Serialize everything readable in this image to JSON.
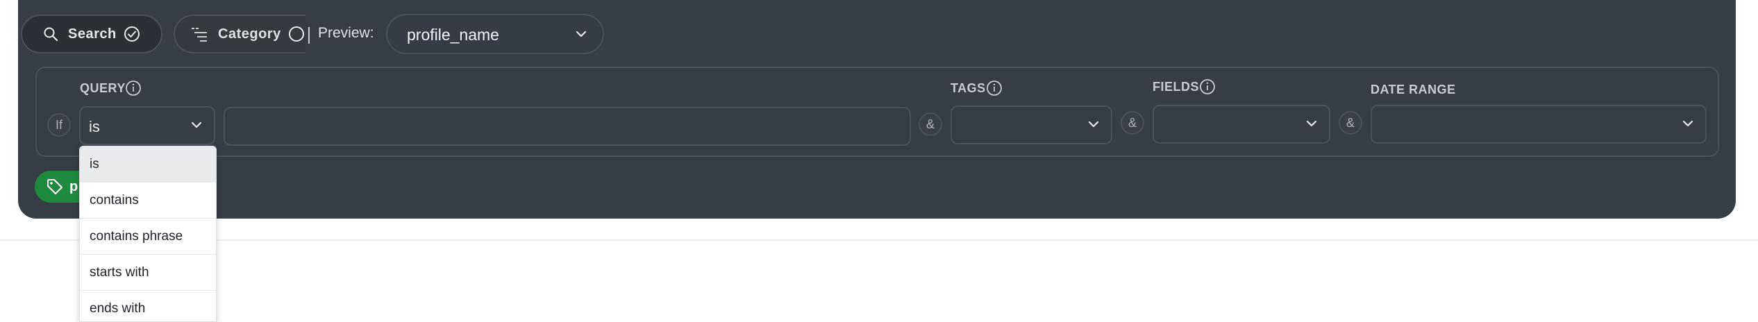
{
  "toolbar": {
    "search_label": "Search",
    "category_label": "Category",
    "preview_label": "Preview:",
    "preview_value": "profile_name"
  },
  "filter": {
    "if_label": "If",
    "query_label": "QUERY",
    "query_operator": "is",
    "query_value": "",
    "and_label": "&",
    "tags_label": "TAGS",
    "fields_label": "FIELDS",
    "date_range_label": "DATE RANGE"
  },
  "badge": {
    "text": "p"
  },
  "dropdown": {
    "options": [
      "is",
      "contains",
      "contains phrase",
      "starts with",
      "ends with"
    ],
    "selected": "is"
  },
  "colors": {
    "panel": "#373d44",
    "badge": "#1f8a3e",
    "dropdown_active": "#e9eaec"
  },
  "icons": [
    "search-icon",
    "check-circle-icon",
    "filter-lines-icon",
    "empty-circle-icon",
    "chevron-down-icon",
    "info-icon",
    "tag-icon"
  ]
}
